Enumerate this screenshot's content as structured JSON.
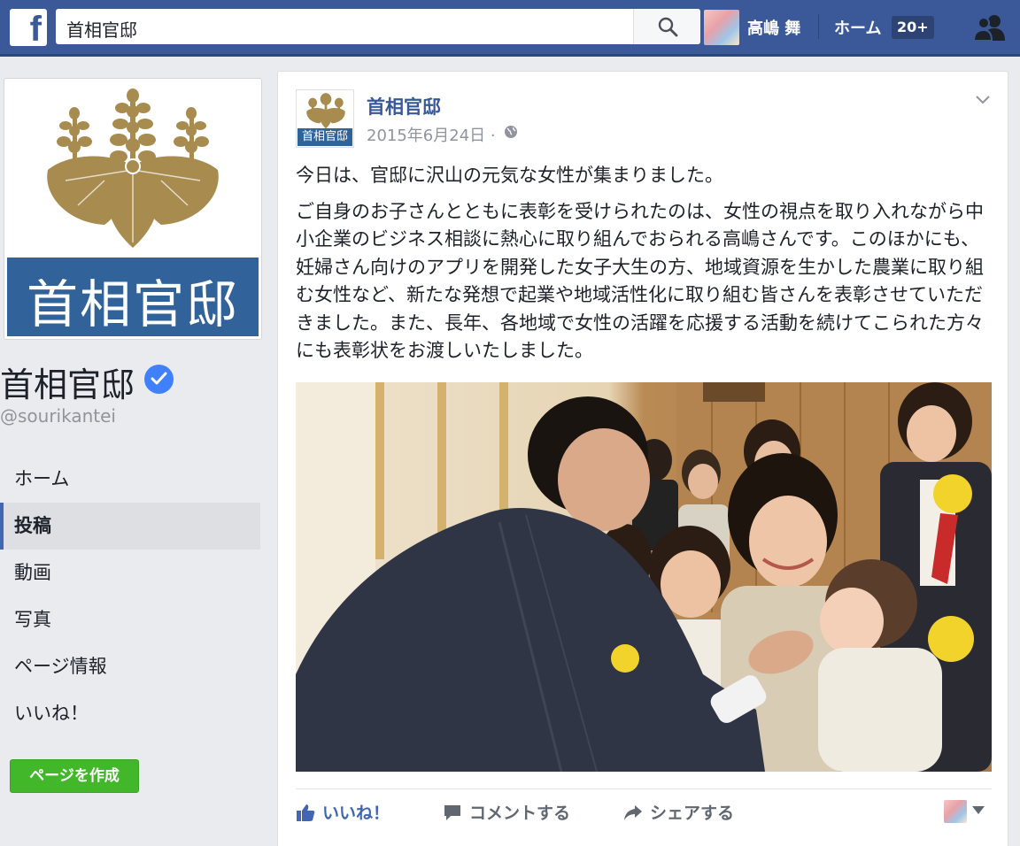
{
  "topbar": {
    "logo_letter": "f",
    "search_value": "首相官邸",
    "user_name": "高嶋 舞",
    "home_label": "ホーム",
    "notif_badge": "20+"
  },
  "page": {
    "banner_text": "首相官邸",
    "name": "首相官邸",
    "handle": "@sourikantei",
    "nav": [
      {
        "label": "ホーム"
      },
      {
        "label": "投稿"
      },
      {
        "label": "動画"
      },
      {
        "label": "写真"
      },
      {
        "label": "ページ情報"
      },
      {
        "label": "いいね！"
      }
    ],
    "create_button": "ページを作成"
  },
  "post": {
    "avatar_text": "首相官邸",
    "author": "首相官邸",
    "date": "2015年6月24日 ·",
    "paragraph1": "今日は、官邸に沢山の元気な女性が集まりました。",
    "paragraph2": "ご自身のお子さんとともに表彰を受けられたのは、女性の視点を取り入れながら中小企業のビジネス相談に熱心に取り組んでおられる高嶋さんです。このほかにも、妊婦さん向けのアプリを開発した女子大生の方、地域資源を生かした農業に取り組む女性など、新たな発想で起業や地域活性化に取り組む皆さんを表彰させていただきました。また、長年、各地域で女性の活躍を応援する活動を続けてこられた方々にも表彰状をお渡しいたしました。",
    "actions": {
      "like": "いいね！",
      "comment": "コメントする",
      "share": "シェアする"
    }
  },
  "colors": {
    "facebook_blue": "#3b5998",
    "link_blue": "#365899",
    "banner_blue": "#31639a",
    "crest_gold": "#a88c4f",
    "create_green": "#42b72a"
  }
}
